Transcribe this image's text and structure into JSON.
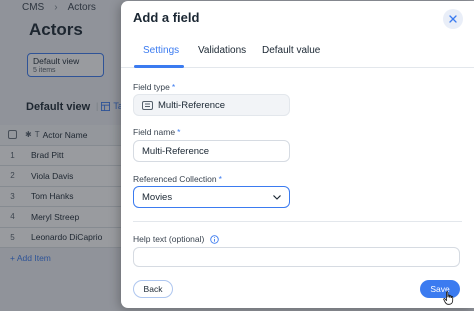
{
  "background": {
    "breadcrumb": [
      "CMS",
      "Actors"
    ],
    "page_title": "Actors",
    "view_card": {
      "name": "Default view",
      "count": "5 items"
    },
    "section_title": "Default view",
    "table_link": "Tal",
    "table": {
      "header": "Actor Name",
      "rows": [
        {
          "num": "1",
          "name": "Brad Pitt"
        },
        {
          "num": "2",
          "name": "Viola Davis"
        },
        {
          "num": "3",
          "name": "Tom Hanks"
        },
        {
          "num": "4",
          "name": "Meryl Streep"
        },
        {
          "num": "5",
          "name": "Leonardo DiCaprio"
        }
      ]
    },
    "add_item": "+ Add Item"
  },
  "modal": {
    "title": "Add a field",
    "tabs": [
      {
        "label": "Settings",
        "active": true
      },
      {
        "label": "Validations",
        "active": false
      },
      {
        "label": "Default value",
        "active": false
      }
    ],
    "field_type": {
      "label": "Field type",
      "required_mark": "*",
      "value": "Multi-Reference"
    },
    "field_name": {
      "label": "Field name",
      "required_mark": "*",
      "value": "Multi-Reference"
    },
    "referenced_collection": {
      "label": "Referenced Collection",
      "required_mark": "*",
      "value": "Movies"
    },
    "help_text": {
      "label": "Help text (optional)",
      "value": ""
    },
    "back_label": "Back",
    "save_label": "Save"
  },
  "colors": {
    "accent": "#3b7bf0",
    "text": "#1b2733",
    "overlay": "rgba(32,38,46,0.46)"
  }
}
